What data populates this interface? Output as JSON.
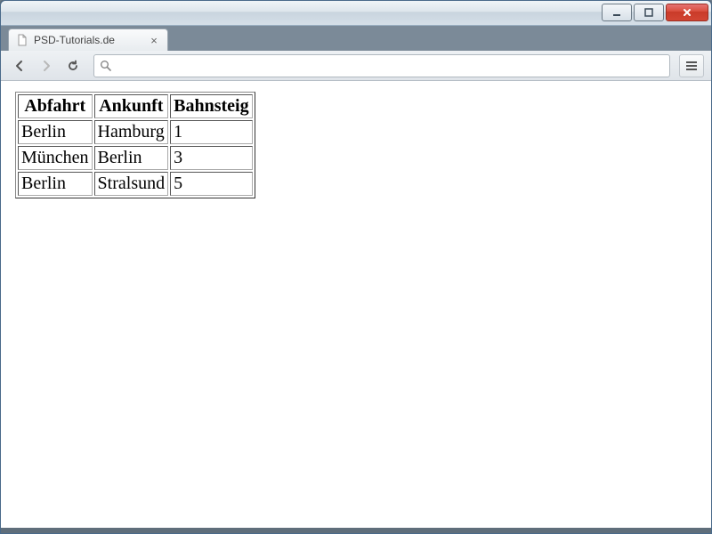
{
  "window": {
    "tab_title": "PSD-Tutorials.de"
  },
  "toolbar": {
    "url_value": ""
  },
  "table": {
    "headers": [
      "Abfahrt",
      "Ankunft",
      "Bahnsteig"
    ],
    "rows": [
      {
        "abfahrt": "Berlin",
        "ankunft": "Hamburg",
        "bahnsteig": "1"
      },
      {
        "abfahrt": "München",
        "ankunft": "Berlin",
        "bahnsteig": "3"
      },
      {
        "abfahrt": "Berlin",
        "ankunft": "Stralsund",
        "bahnsteig": "5"
      }
    ]
  }
}
